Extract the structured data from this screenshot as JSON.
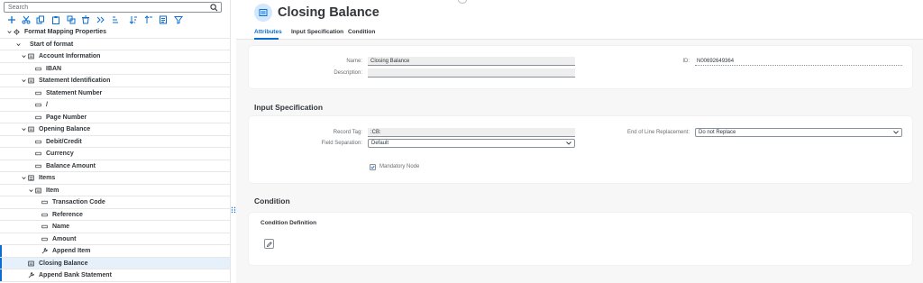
{
  "search": {
    "placeholder": "Search"
  },
  "toolbar": {
    "icons": [
      "add-icon",
      "cut-icon",
      "copy-icon",
      "paste-icon",
      "delete-icon",
      "move-icon",
      "expand-icon",
      "sort-icon",
      "collapse-icon",
      "details-icon",
      "filter-icon"
    ]
  },
  "tree": [
    {
      "label": "Format Mapping Properties",
      "level": 0,
      "expanded": true,
      "icon": "gear-icon"
    },
    {
      "label": "Start of format",
      "level": 1,
      "expanded": true,
      "icon": "none"
    },
    {
      "label": "Account Information",
      "level": 2,
      "expanded": true,
      "icon": "record-icon"
    },
    {
      "label": "IBAN",
      "level": 3,
      "icon": "field-icon"
    },
    {
      "label": "Statement Identification",
      "level": 2,
      "expanded": true,
      "icon": "record-icon"
    },
    {
      "label": "Statement Number",
      "level": 3,
      "icon": "field-icon"
    },
    {
      "label": "/",
      "level": 3,
      "icon": "field-icon"
    },
    {
      "label": "Page Number",
      "level": 3,
      "icon": "field-icon"
    },
    {
      "label": "Opening Balance",
      "level": 2,
      "expanded": true,
      "icon": "record-icon"
    },
    {
      "label": "Debit/Credit",
      "level": 3,
      "icon": "field-icon"
    },
    {
      "label": "Currency",
      "level": 3,
      "icon": "field-icon"
    },
    {
      "label": "Balance Amount",
      "level": 3,
      "icon": "field-icon"
    },
    {
      "label": "Items",
      "level": 2,
      "expanded": true,
      "icon": "list-icon"
    },
    {
      "label": "Item",
      "level": 3,
      "expanded": true,
      "icon": "record-icon"
    },
    {
      "label": "Transaction Code",
      "level": 4,
      "icon": "field-icon"
    },
    {
      "label": "Reference",
      "level": 4,
      "icon": "field-icon"
    },
    {
      "label": "Name",
      "level": 4,
      "icon": "field-icon"
    },
    {
      "label": "Amount",
      "level": 4,
      "icon": "field-icon"
    },
    {
      "label": "Append Item",
      "level": 4,
      "icon": "wrench-icon",
      "marked": true
    },
    {
      "label": "Closing Balance",
      "level": 2,
      "icon": "record-icon",
      "selected": true
    },
    {
      "label": "Append Bank Statement",
      "level": 2,
      "icon": "wrench-icon",
      "marked": true
    }
  ],
  "header": {
    "title": "Closing Balance"
  },
  "tabs": [
    "Attributes",
    "Input Specification",
    "Condition"
  ],
  "attributes": {
    "name_label": "Name:",
    "name_value": "Closing Balance",
    "description_label": "Description:",
    "description_value": "",
    "id_label": "ID:",
    "id_value": "N00692649364"
  },
  "input_spec": {
    "title": "Input Specification",
    "record_tag_label": "Record Tag:",
    "record_tag_value": ":CB:",
    "field_separation_label": "Field Separation:",
    "field_separation_value": "Default",
    "eol_label": "End of Line Replacement:",
    "eol_value": "Do not Replace",
    "mandatory_label": "Mandatory Node",
    "mandatory_checked": true
  },
  "condition": {
    "title": "Condition",
    "definition_label": "Condition Definition"
  },
  "colors": {
    "accent": "#0a6ed1",
    "selected_row": "#e5f0fa",
    "icon_circle": "#d1e8ff"
  }
}
